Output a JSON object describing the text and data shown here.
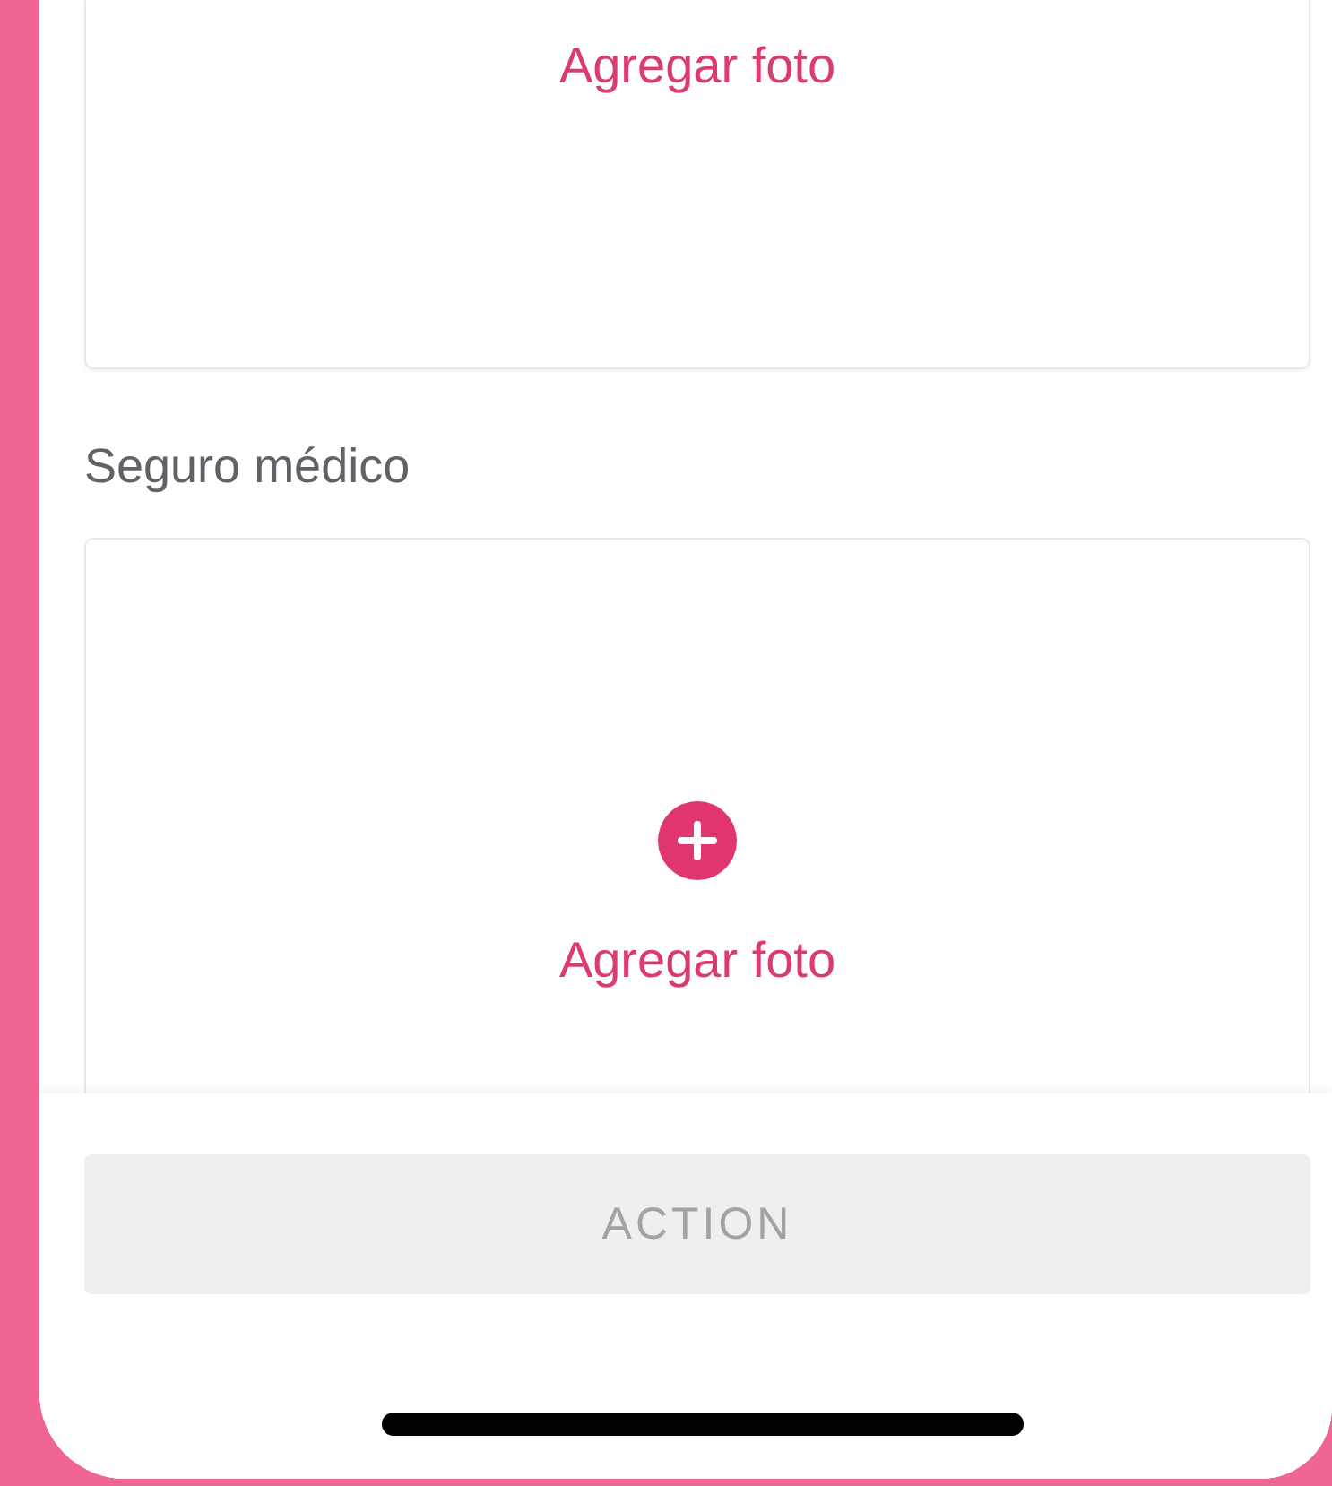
{
  "photo_sections": [
    {
      "kind": "partial",
      "add_label": "Agregar foto"
    },
    {
      "kind": "full",
      "title": "Seguro médico",
      "add_label": "Agregar foto"
    }
  ],
  "action_button": {
    "label": "ACTION",
    "disabled": true
  }
}
